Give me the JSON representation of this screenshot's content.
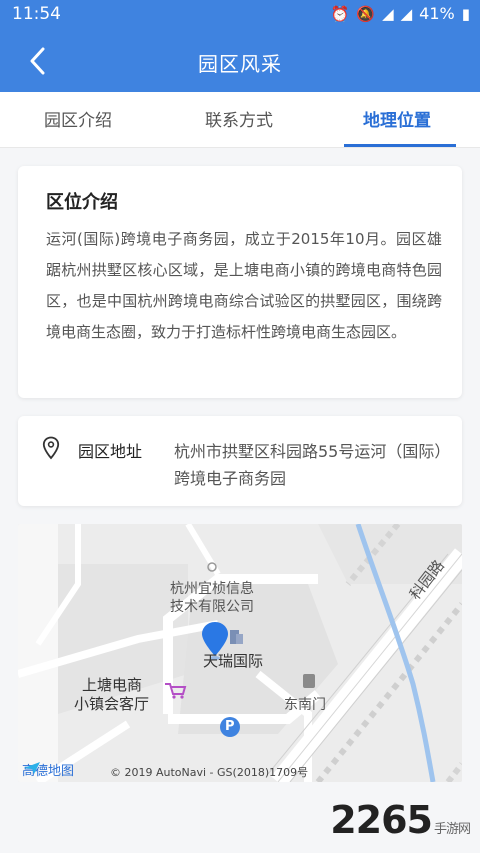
{
  "status_bar": {
    "time": "11:54",
    "battery": "41%"
  },
  "header": {
    "title": "园区风采"
  },
  "tabs": [
    {
      "label": "园区介绍"
    },
    {
      "label": "联系方式"
    },
    {
      "label": "地理位置"
    }
  ],
  "intro": {
    "title": "区位介绍",
    "text": "运河(国际)跨境电子商务园，成立于2015年10月。园区雄踞杭州拱墅区核心区域，是上塘电商小镇的跨境电商特色园区，也是中国杭州跨境电商综合试验区的拱墅园区，围绕跨境电商生态圈，致力于打造标杆性跨境电商生态园区。"
  },
  "address": {
    "label": "园区地址",
    "value": "杭州市拱墅区科园路55号运河（国际）跨境电子商务园"
  },
  "map": {
    "poi_1": "杭州宜桢信息",
    "poi_1b": "技术有限公司",
    "poi_2": "天瑞国际",
    "poi_3": "上塘电商",
    "poi_3b": "小镇会客厅",
    "poi_4": "东南门",
    "road": "科园路",
    "logo": "高德地图",
    "copyright": "© 2019 AutoNavi - GS(2018)1709号",
    "parking": "P"
  },
  "watermark": {
    "text": "2265",
    "sub": "手游网"
  },
  "colors": {
    "primary": "#3f83e0",
    "tab_active": "#2a6fd6"
  }
}
